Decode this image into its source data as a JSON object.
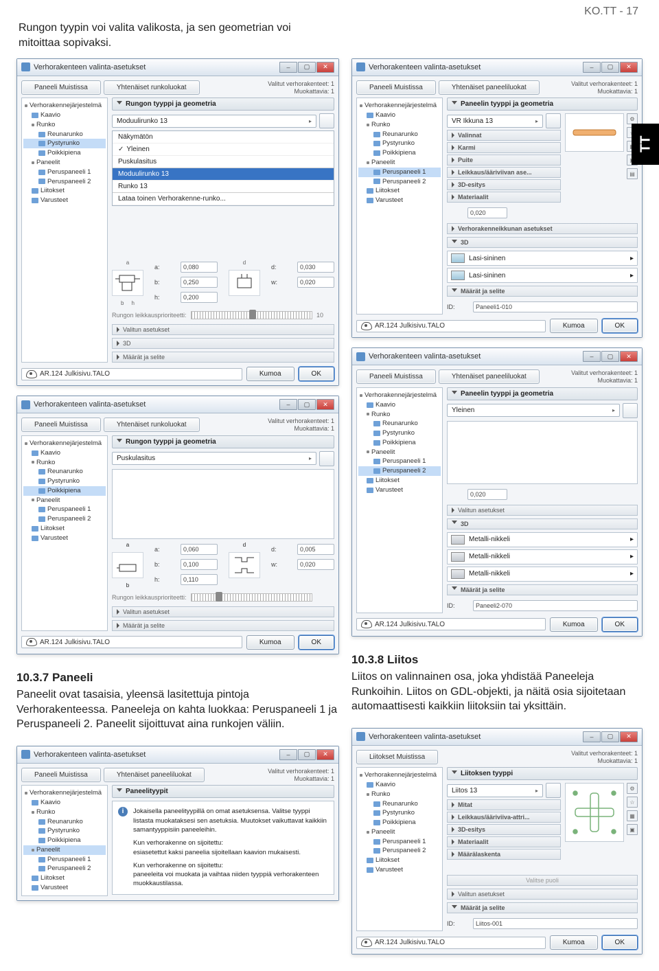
{
  "page_header": "KO.TT - 17",
  "tab_label": "TT",
  "intro": "Rungon tyypin voi valita valikosta, ja sen geometrian voi mitoittaa sopivaksi.",
  "section_10_3_7": {
    "heading": "10.3.7  Paneeli",
    "body": "Paneelit ovat tasaisia, yleensä lasitettuja pintoja Verhorakenteessa. Paneeleja on kahta luokkaa: Peruspaneeli 1 ja Peruspaneeli 2. Paneelit sijoittuvat aina runkojen väliin."
  },
  "section_10_3_8": {
    "heading": "10.3.8  Liitos",
    "body": "Liitos on valinnainen osa, joka yhdistää Paneeleja Runkoihin. Liitos on GDL-objekti, ja näitä osia sijoitetaan automaattisesti kaikkiin liitoksiin tai yksittäin."
  },
  "common": {
    "window_title": "Verhorakenteen valinta-asetukset",
    "tab_paneeli": "Paneeli Muistissa",
    "tab_runko": "Yhtenäiset runkoluokat",
    "tab_paneeliluokat": "Yhtenäiset paneeliluokat",
    "tab_liitokset": "Liitokset Muistissa",
    "stat1": "Valitut verhorakenteet: 1",
    "stat2": "Muokattavia: 1",
    "layer_name": "AR.124 Julkisivu.TALO",
    "btn_kumoa": "Kumoa",
    "btn_ok": "OK",
    "id_label": "ID:"
  },
  "tree_full": [
    "Verhorakennejärjestelmä",
    "Kaavio",
    "Runko",
    "Reunarunko",
    "Pystyrunko",
    "Poikkipiena",
    "Paneelit",
    "Peruspaneeli 1",
    "Peruspaneeli 2",
    "Liitokset",
    "Varusteet"
  ],
  "dialog1": {
    "group_hdr": "Rungon tyyppi ja geometria",
    "selected": "Moduulirunko 13",
    "drop": {
      "top": [
        "Näkymätön",
        "Yleinen",
        "Puskulasitus"
      ],
      "mid_hl": "Moduulirunko 13",
      "mid": [
        "Runko 13"
      ],
      "bottom": "Lataa toinen Verhorakenne-runko..."
    },
    "dims": {
      "a": "a:",
      "av": "0,080",
      "b": "b:",
      "bv": "0,250",
      "h": "h:",
      "hv": "0,200",
      "d": "d:",
      "dv": "0,030",
      "w": "w:",
      "wv": "0,020"
    },
    "prio_label": "Rungon leikkausprioriteetti:",
    "prio_val": "10",
    "band_valitun": "Valitun asetukset",
    "band_3d": "3D",
    "band_maarat": "Määrät ja selite"
  },
  "dialog2": {
    "group_hdr": "Rungon tyyppi ja geometria",
    "selected": "Puskulasitus",
    "dims": {
      "a": "a:",
      "av": "0,060",
      "b": "b:",
      "bv": "0,100",
      "h": "h:",
      "hv": "0,110",
      "d": "d:",
      "dv": "0,005",
      "w": "w:",
      "wv": "0,020"
    },
    "prio_label": "Rungon leikkausprioriteetti:",
    "band_valitun": "Valitun asetukset",
    "band_maarat": "Määrät ja selite"
  },
  "dialog3": {
    "group_hdr": "Paneelin tyyppi ja geometria",
    "selected": "VR Ikkuna 13",
    "tree_sel": "Peruspaneeli 1",
    "props": [
      "Valinnat",
      "Karmi",
      "Puite",
      "Leikkaus/ääriviivan ase...",
      "3D-esitys",
      "Materiaalit"
    ],
    "thick": "0,020",
    "band_verho": "Verhorakenneikkunan asetukset",
    "band_3d": "3D",
    "mat": "Lasi-sininen",
    "band_maarat": "Määrät ja selite",
    "id_val": "Paneeli1-010"
  },
  "dialog4": {
    "group_hdr": "Paneelin tyyppi ja geometria",
    "selected": "Yleinen",
    "tree_sel": "Peruspaneeli 2",
    "thick": "0,020",
    "band_valitun": "Valitun asetukset",
    "band_3d": "3D",
    "mat": "Metalli-nikkeli",
    "band_maarat": "Määrät ja selite",
    "id_val": "Paneeli2-070"
  },
  "dialog5": {
    "group_hdr": "Paneelityypit",
    "tree_sel": "Paneelit",
    "info_line1": "Jokaisella paneelityypillä on omat asetuksensa. Valitse tyyppi listasta muokataksesi sen asetuksia. Muutokset vaikuttavat kaikkiin samantyyppisiin paneeleihin.",
    "info_h1": "Kun verhorakenne on sijoitettu:",
    "info_l1": "esiasetettut kaksi paneelia sijoitellaan kaavion mukaisesti.",
    "info_h2": "Kun verhorakenne on sijoitettu:",
    "info_l2": "paneeleita voi muokata ja vaihtaa niiden tyyppiä verhorakenteen muokkaustilassa."
  },
  "dialog6": {
    "group_hdr": "Liitoksen tyyppi",
    "selected": "Liitos 13",
    "props": [
      "Mitat",
      "Leikkaus/ääriviiva-attri...",
      "3D-esitys",
      "Materiaalit",
      "Määrälaskenta"
    ],
    "band_valitse": "Valitse puoli",
    "band_valitun": "Valitun asetukset",
    "band_maarat": "Määrät ja selite",
    "id_val": "Liitos-001"
  }
}
